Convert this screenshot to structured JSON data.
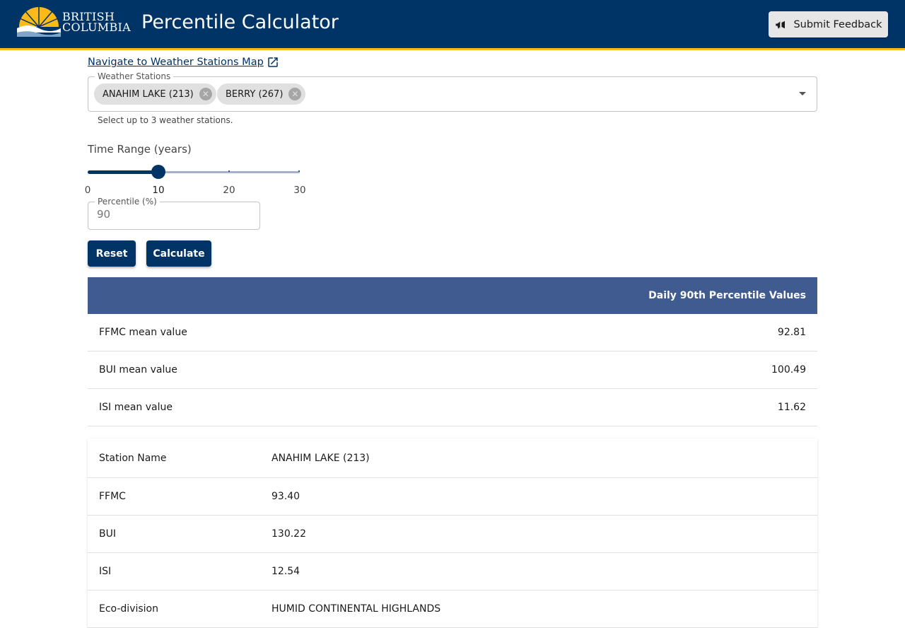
{
  "header": {
    "logo_line1": "BRITISH",
    "logo_line2": "COLUMBIA",
    "title": "Percentile Calculator",
    "feedback_label": "Submit Feedback",
    "feedback_icon": "megaphone-icon",
    "bg_color": "#003366",
    "accent_color": "#fcba19"
  },
  "map_link": {
    "label": "Navigate to Weather Stations Map",
    "icon": "external-link-icon"
  },
  "stations": {
    "legend": "Weather Stations",
    "chips": [
      {
        "label": "ANAHIM LAKE (213)"
      },
      {
        "label": "BERRY (267)"
      }
    ],
    "helper": "Select up to 3 weather stations."
  },
  "time_range": {
    "label": "Time Range (years)",
    "min": 0,
    "max": 30,
    "value": 10,
    "marks": [
      "0",
      "10",
      "20",
      "30"
    ]
  },
  "percentile": {
    "legend": "Percentile (%)",
    "value": "90"
  },
  "buttons": {
    "reset": "Reset",
    "calculate": "Calculate"
  },
  "mean_table": {
    "header": "Daily 90th Percentile Values",
    "rows": [
      {
        "label": "FFMC mean value",
        "value": "92.81"
      },
      {
        "label": "BUI mean value",
        "value": "100.49"
      },
      {
        "label": "ISI mean value",
        "value": "11.62"
      }
    ]
  },
  "station_table": {
    "rows": [
      {
        "label": "Station Name",
        "value": "ANAHIM LAKE (213)"
      },
      {
        "label": "FFMC",
        "value": "93.40"
      },
      {
        "label": "BUI",
        "value": "130.22"
      },
      {
        "label": "ISI",
        "value": "12.54"
      },
      {
        "label": "Eco-division",
        "value": "HUMID CONTINENTAL HIGHLANDS"
      }
    ]
  }
}
